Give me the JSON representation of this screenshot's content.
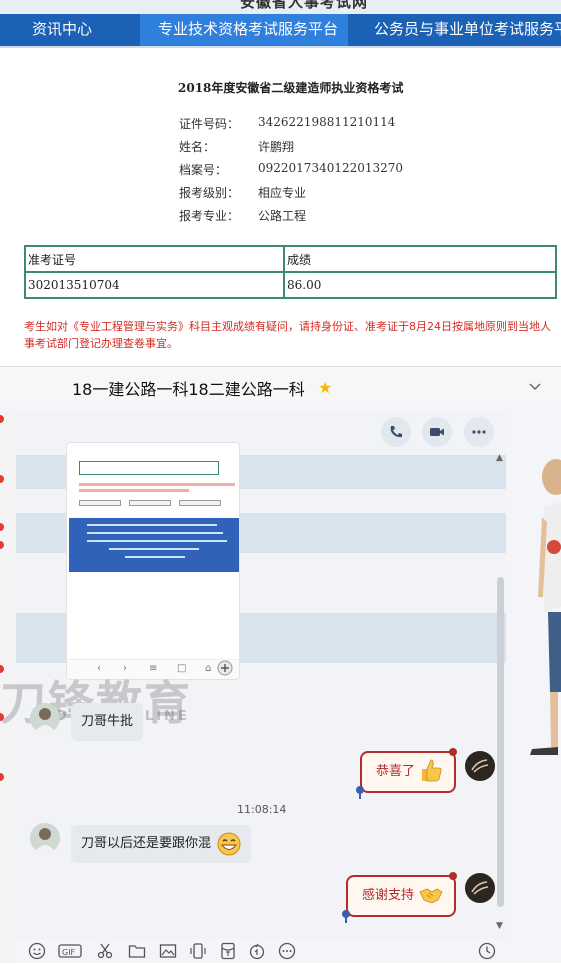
{
  "web": {
    "site_title": "安徽省人事考试网",
    "nav_tabs": [
      {
        "label": "资讯中心"
      },
      {
        "label": "专业技术资格考试服务平台"
      },
      {
        "label": "公务员与事业单位考试服务平台"
      }
    ],
    "exam_title": "2018年度安徽省二级建造师执业资格考试",
    "info": [
      {
        "label": "证件号码：",
        "value": "342622198811210114"
      },
      {
        "label": "姓名：",
        "value": "许鹏翔"
      },
      {
        "label": "档案号：",
        "value": "0922017340122013270"
      },
      {
        "label": "报考级别：",
        "value": "相应专业"
      },
      {
        "label": "报考专业：",
        "value": "公路工程"
      }
    ],
    "score_table": {
      "headers": [
        "准考证号",
        "成绩"
      ],
      "rows": [
        [
          "302013510704",
          "86.00"
        ]
      ]
    },
    "notice": "考生如对《专业工程管理与实务》科目主观成绩有疑问，请持身份证、准考证于8月24日按属地原则到当地人事考试部门登记办理查卷事宜。"
  },
  "chat": {
    "title": "18一建公路一科18二建公路一科",
    "watermark": "刀锋教育",
    "watermark_sub": "DF JY ONLINE",
    "messages": [
      {
        "side": "left",
        "text": "刀哥牛批"
      },
      {
        "side": "right",
        "text": "恭喜了"
      },
      {
        "side": "left",
        "text": "刀哥以后还是要跟你混"
      },
      {
        "side": "right",
        "text": "感谢支持"
      }
    ],
    "timestamp": "11:08:14",
    "toolbar_icons": [
      "smile-icon",
      "gif-icon",
      "scissors-icon",
      "folder-icon",
      "image-icon",
      "shake-icon",
      "red-packet-icon",
      "voice-icon",
      "more-icon",
      "history-icon"
    ]
  },
  "colors": {
    "nav_bg": "#1b61b6",
    "nav_active": "#2f7fdc",
    "table_border": "#3d8a74",
    "notice_red": "#d42b22",
    "bubble_red": "#b22c2c"
  }
}
